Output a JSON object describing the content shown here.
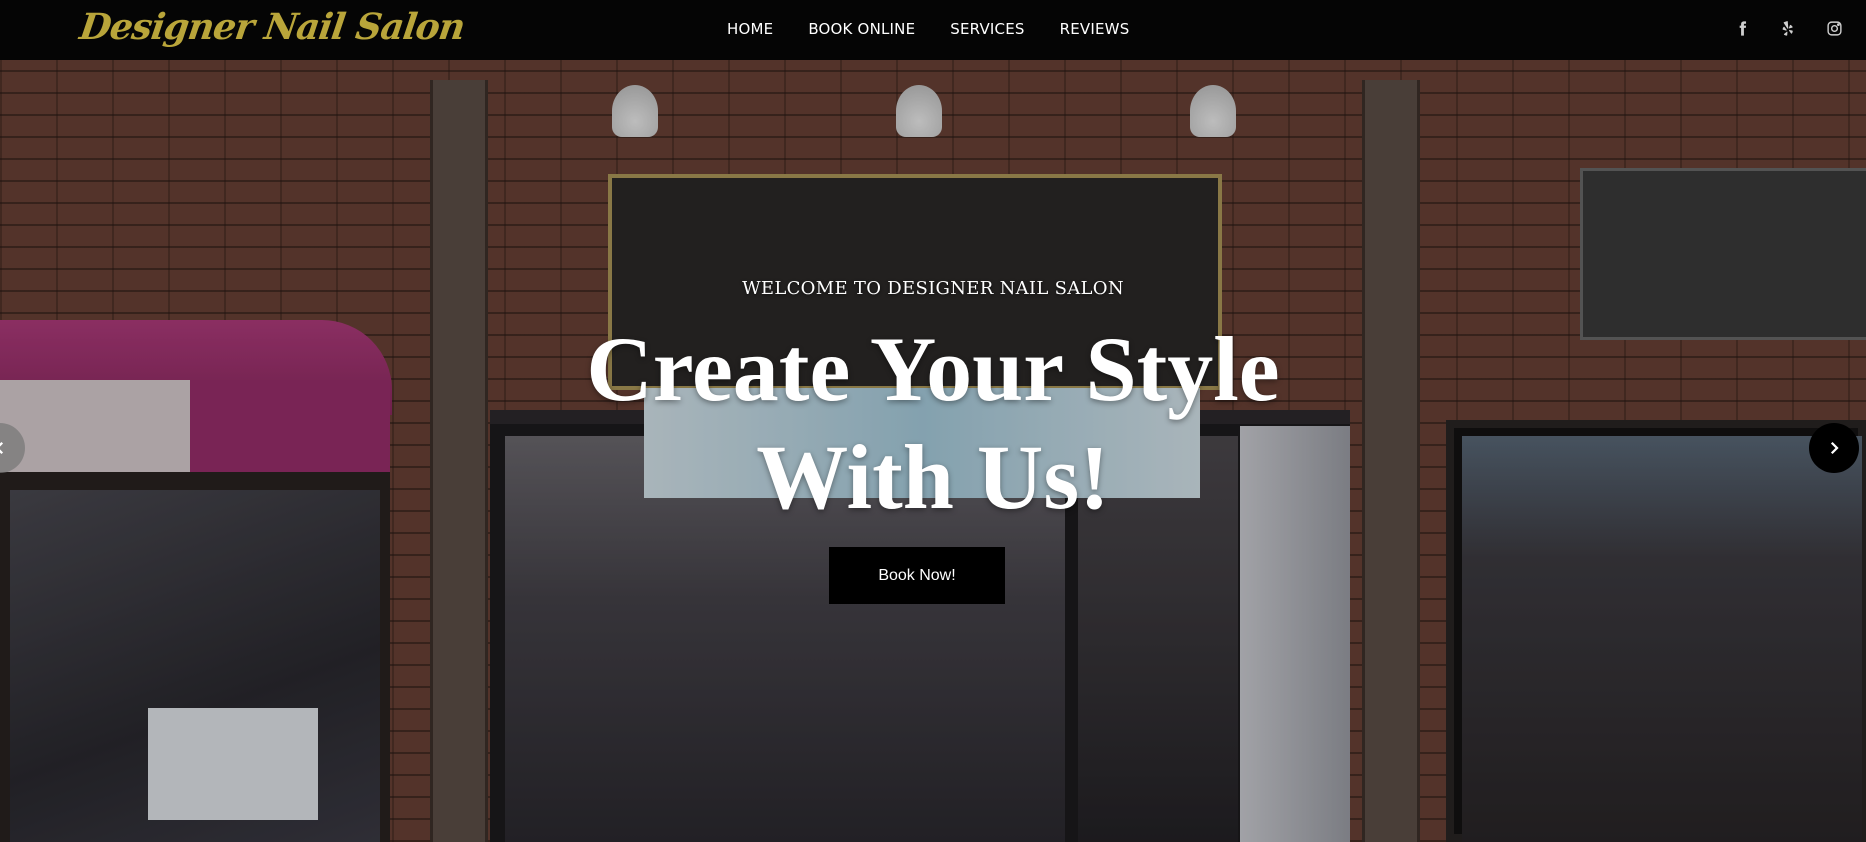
{
  "header": {
    "logo_text": "Designer Nail Salon",
    "nav": [
      "HOME",
      "BOOK ONLINE",
      "SERVICES",
      "REVIEWS"
    ],
    "social_icons": [
      "facebook-icon",
      "yelp-icon",
      "instagram-icon"
    ]
  },
  "hero": {
    "eyebrow": "WELCOME TO DESIGNER NAIL SALON",
    "headline_line1": "Create Your Style",
    "headline_line2": "With Us!",
    "cta_label": "Book Now!",
    "prev_icon": "chevron-left-icon",
    "next_icon": "chevron-right-icon"
  },
  "colors": {
    "header_bg": "#050505",
    "logo": "#b9a53a",
    "cta_bg": "#000000",
    "text": "#ffffff"
  }
}
